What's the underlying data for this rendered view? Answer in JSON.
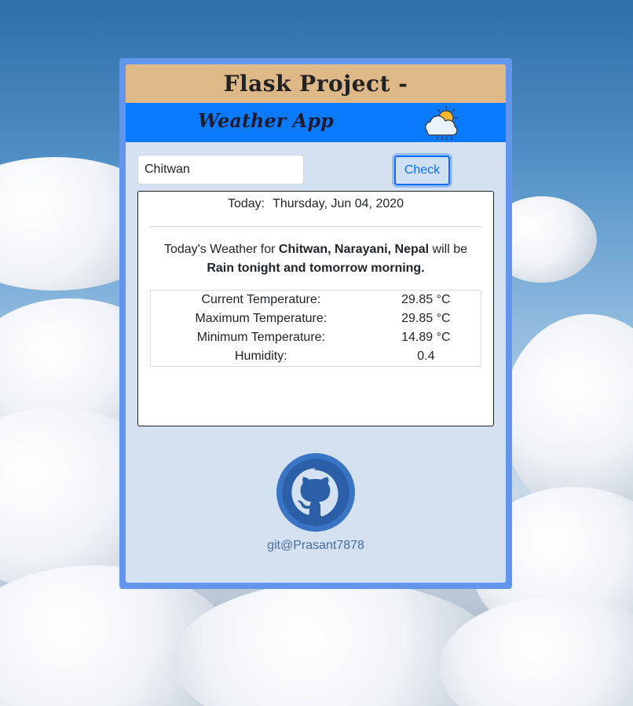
{
  "header": {
    "title": "Flask Project -",
    "subtitle": "Weather App"
  },
  "search": {
    "value": "Chitwan",
    "button_label": "Check"
  },
  "result": {
    "today_label": "Today:",
    "date": "Thursday, Jun 04, 2020",
    "forecast_prefix": "Today's Weather for",
    "location": "Chitwan, Narayani, Nepal",
    "forecast_middle": "will be",
    "forecast": "Rain tonight and tomorrow morning.",
    "stats": [
      {
        "label": "Current Temperature:",
        "value": "29.85 °C"
      },
      {
        "label": "Maximum Temperature:",
        "value": "29.85 °C"
      },
      {
        "label": "Minimum Temperature:",
        "value": "14.89 °C"
      },
      {
        "label": "Humidity:",
        "value": "0.4"
      }
    ]
  },
  "footer": {
    "git_link": "git@Prasant7878"
  },
  "colors": {
    "frame": "#6495ed",
    "panel": "#d3e1f0",
    "title_bar": "#deb887",
    "subtitle_bar": "#0a7bff",
    "button": "#0d6efd"
  },
  "icons": [
    "weather-sun-cloud-rain-icon",
    "github-icon"
  ]
}
